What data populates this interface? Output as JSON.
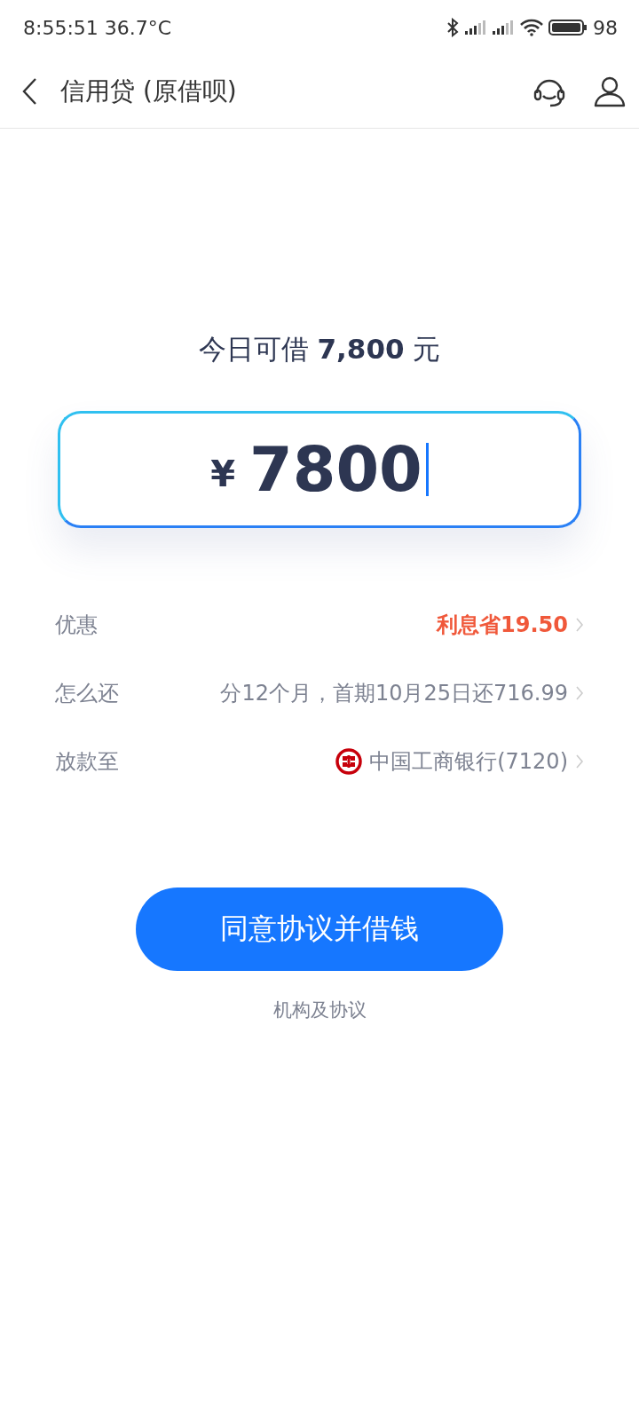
{
  "status_bar": {
    "time": "8:55:51 36.7°C",
    "battery": "98"
  },
  "header": {
    "title": "信用贷 (原借呗)"
  },
  "quota": "今日可借 **7,800** 元",
  "amount_field": {
    "currency": "¥",
    "value": "7800"
  },
  "rows": [
    {
      "label": "优惠",
      "value": "利息省19.50",
      "kind": "promo"
    },
    {
      "label": "怎么还",
      "value": "分12个月，首期10月25日还716.99",
      "kind": "plain"
    },
    {
      "label": "放款至",
      "value": "中国工商银行(7120)",
      "kind": "bank"
    }
  ],
  "primary_button": "同意协议并借钱",
  "link": "机构及协议"
}
